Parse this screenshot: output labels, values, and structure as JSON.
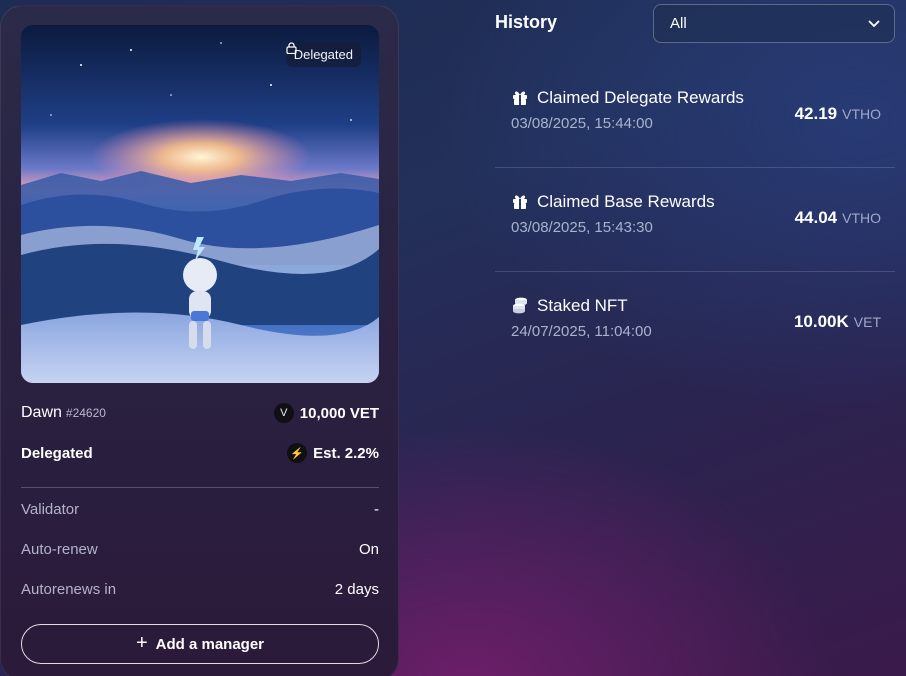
{
  "nft": {
    "badge": "Delegated",
    "name": "Dawn",
    "id": "#24620",
    "stake": "10,000 VET",
    "status": "Delegated",
    "estimate": "Est. 2.2%",
    "details": [
      {
        "label": "Validator",
        "value": "-"
      },
      {
        "label": "Auto-renew",
        "value": "On"
      },
      {
        "label": "Autorenews in",
        "value": "2 days"
      }
    ],
    "add_manager_label": "Add a manager"
  },
  "history": {
    "title": "History",
    "filter": "All",
    "items": [
      {
        "icon": "gift-icon",
        "title": "Claimed Delegate Rewards",
        "date": "03/08/2025, 15:44:00",
        "amount": "42.19",
        "unit": "VTHO"
      },
      {
        "icon": "gift-icon",
        "title": "Claimed Base Rewards",
        "date": "03/08/2025, 15:43:30",
        "amount": "44.04",
        "unit": "VTHO"
      },
      {
        "icon": "coins-stack-icon",
        "title": "Staked NFT",
        "date": "24/07/2025, 11:04:00",
        "amount": "10.00K",
        "unit": "VET"
      }
    ]
  },
  "colors": {
    "accent": "#ffffff",
    "muted": "#b4b3c8"
  }
}
